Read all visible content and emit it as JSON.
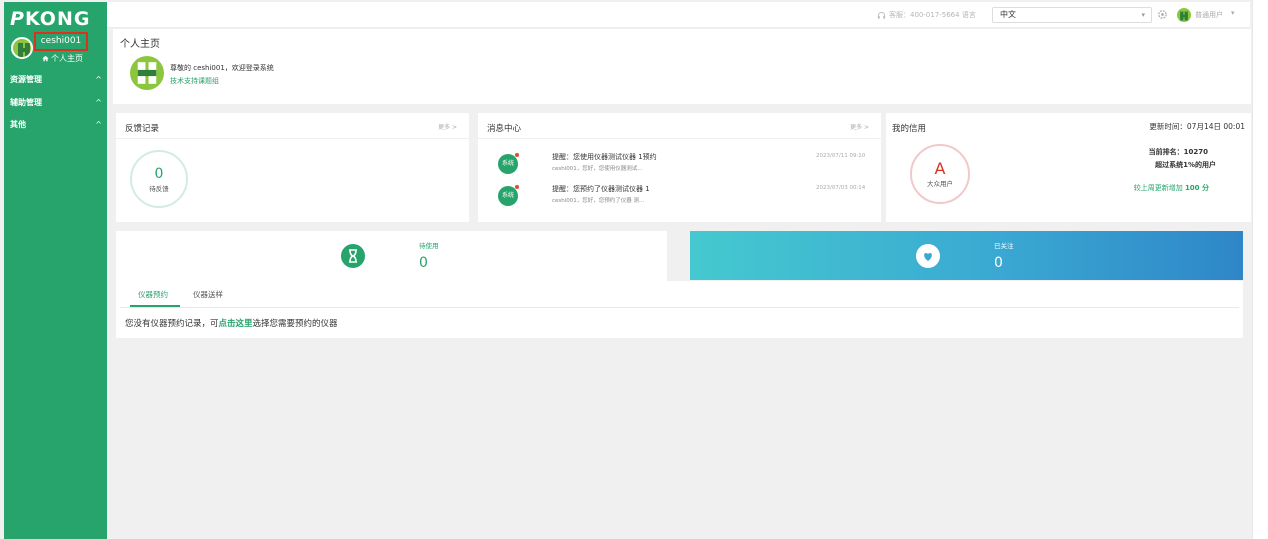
{
  "brand": {
    "logo_mark": "P",
    "logo_text": "KONG"
  },
  "sidebar": {
    "username": "ceshi001",
    "home_label": "个人主页",
    "menu": [
      {
        "label": "资源管理"
      },
      {
        "label": "辅助管理"
      },
      {
        "label": "其他"
      }
    ]
  },
  "topbar": {
    "service": "客服：400-017-5664 语言",
    "language": "中文",
    "user_role": "普通用户"
  },
  "header": {
    "title": "个人主页",
    "welcome": "尊敬的 ceshi001，欢迎登录系统",
    "support": "技术支持课题组"
  },
  "feedback": {
    "title": "反馈记录",
    "more": "更多 >",
    "count": "0",
    "count_label": "待反馈"
  },
  "messages": {
    "title": "消息中心",
    "more": "更多 >",
    "items": [
      {
        "icon": "系统",
        "title": "提醒：您使用仪器测试仪器 1预约",
        "sub": "ceshi001，您好，您使用仪器测试...",
        "time": "2023/07/11 09:10"
      },
      {
        "icon": "系统",
        "title": "提醒：您预约了仪器测试仪器 1",
        "sub": "ceshi001，您好，您预约了仪器 测...",
        "time": "2023/07/03 00:14"
      }
    ]
  },
  "credit": {
    "title": "我的信用",
    "update_label": "更新时间：",
    "update_time": "07月14日 00:01",
    "grade": "A",
    "grade_label": "大众用户",
    "rank": "当前排名：10270",
    "exceed": "超过系统1%的用户",
    "weekly_prefix": "较上周更新增加 ",
    "weekly_value": "100 分"
  },
  "stats": {
    "pending": {
      "label": "待使用",
      "value": "0"
    },
    "followed": {
      "label": "已关注",
      "value": "0"
    }
  },
  "tabs": [
    {
      "label": "仪器预约"
    },
    {
      "label": "仪器送样"
    }
  ],
  "empty": {
    "prefix": "您没有仪器预约记录，可",
    "link": "点击这里",
    "suffix": "选择您需要预约的仪器"
  },
  "colors": {
    "primary": "#27a46b",
    "alert": "#d9331f",
    "blue_start": "#45c9cf",
    "blue_end": "#2f86c8"
  }
}
